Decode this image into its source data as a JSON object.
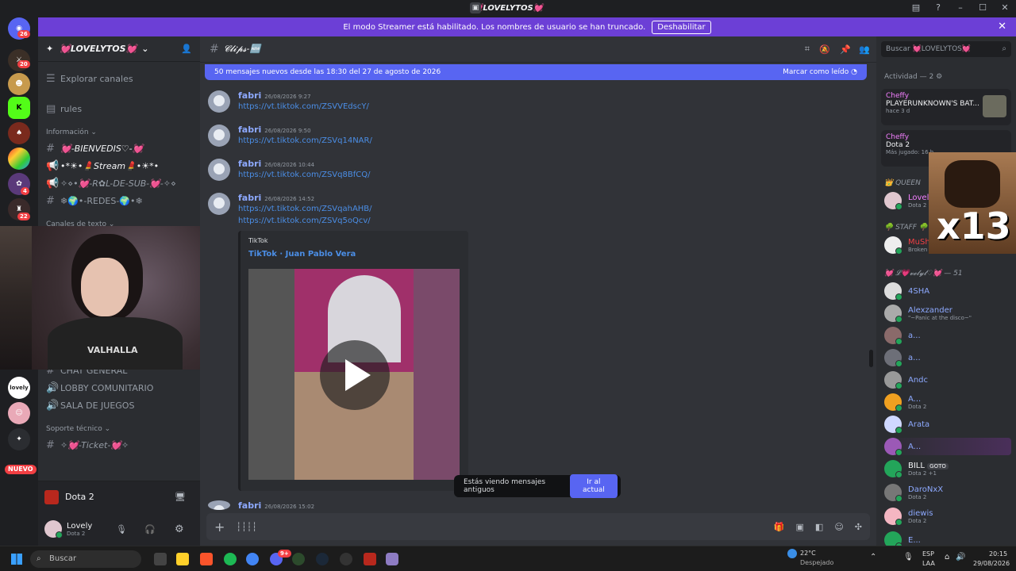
{
  "window": {
    "title": "💓LOVELYTOS💓"
  },
  "streamer": {
    "text": "El modo Streamer está habilitado. Los nombres de usuario se han truncado.",
    "button": "Deshabilitar"
  },
  "guilds": {
    "badge_home": "26",
    "badge_2": "20",
    "badge_3": "4",
    "badge_4": "22",
    "new_label": "NUEVO",
    "lovely_label": "lovely"
  },
  "server": {
    "name": "💓LOVELYTOS💓"
  },
  "sidebar": {
    "explore": "Explorar canales",
    "rules": "rules",
    "cat_info": "Información",
    "ch1": "💓-BIENVEDIS♡-💓",
    "ch2": "•*☀•💄Stream💄•☀*•",
    "ch3": "✧⋄•💓-R✿L-DE-SUB-💓-✧⋄",
    "ch4": "❄🌍•-REDES-🌍•❄",
    "cat_text": "Canales de texto",
    "ch_chat": "CHAT GENERAL",
    "ch_lobby": "LOBBY COMUNITARIO",
    "ch_sala": "SALA DE JUEGOS",
    "cat_support": "Soporte técnico",
    "ch_ticket": "✧💓-Ticket-💓✧"
  },
  "activity_bar": {
    "game": "Dota 2"
  },
  "user": {
    "name": "Lovely",
    "status": "Dota 2"
  },
  "channel": {
    "name": "𝓒𝓵𝓲𝓹𝓼-🆕"
  },
  "newbar": {
    "text": "50 mensajes nuevos desde las 18:30 del 27 de agosto de 2026",
    "action": "Marcar como leído"
  },
  "messages": [
    {
      "author": "fabri",
      "time": "26/08/2026 9:27",
      "link": "https://vt.tiktok.com/ZSVVEdscY/"
    },
    {
      "author": "fabri",
      "time": "26/08/2026 9:50",
      "link": "https://vt.tiktok.com/ZSVq14NAR/"
    },
    {
      "author": "fabri",
      "time": "26/08/2026 10:44",
      "link": "https://vt.tiktok.com/ZSVq8BfCQ/"
    },
    {
      "author": "fabri",
      "time": "26/08/2026 14:52",
      "link": "https://vt.tiktok.com/ZSVqahAHB/",
      "link2": "https://vt.tiktok.com/ZSVq5oQcv/"
    },
    {
      "author": "fabri",
      "time": "26/08/2026 15:02"
    }
  ],
  "embed": {
    "provider": "TikTok",
    "title": "TikTok · Juan Pablo Vera"
  },
  "oldpill": {
    "text": "Estás viendo mensajes antiguos",
    "button": "Ir al actual"
  },
  "right": {
    "search_placeholder": "Buscar 💓LOVELYTOS💓",
    "activity_header": "Actividad — 2",
    "card1": {
      "user": "Cheffy",
      "game": "PLAYERUNKNOWN'S BAT...",
      "meta": "hace 3 d"
    },
    "card2": {
      "user": "Cheffy",
      "game": "Dota 2",
      "meta": "Más jugado: 16 h"
    },
    "cat_queen": "👑 QUEEN",
    "queen_member": {
      "name": "Lovely",
      "sub": "Dota 2"
    },
    "cat_staff": "🌳 STAFF 🌳",
    "staff_member": {
      "name": "MuShU",
      "sub": "Broken"
    },
    "cat_lovelytos": "💓 𝓛💗𝓿𝓮𝓵𝔂𝓽♡💓 — 51",
    "members": [
      {
        "name": "4SHA",
        "sub": ""
      },
      {
        "name": "Alexzander",
        "sub": "\"~Panic at the disco~\""
      },
      {
        "name": "a...",
        "sub": ""
      },
      {
        "name": "a...",
        "sub": ""
      },
      {
        "name": "Andc",
        "sub": ""
      },
      {
        "name": "A...",
        "sub": "Dota 2"
      },
      {
        "name": "Arata",
        "sub": ""
      },
      {
        "name": "A...",
        "sub": ""
      },
      {
        "name": "BILL",
        "sub": "Dota 2 +1",
        "tag": "GOTO"
      },
      {
        "name": "DaroNxX",
        "sub": "Dota 2"
      },
      {
        "name": "diewis",
        "sub": "Dota 2"
      },
      {
        "name": "E...",
        "sub": ""
      }
    ]
  },
  "overlay": {
    "text": "x13"
  },
  "webcam_shirt": "VALHALLA",
  "taskbar": {
    "search": "Buscar",
    "weather_temp": "22°C",
    "weather_desc": "Despejado",
    "lang1": "ESP",
    "lang2": "LAA",
    "time": "20:15",
    "date": "29/08/2026",
    "discord_badge": "9+"
  },
  "colors": {
    "accent": "#5865f2",
    "streamer": "#6c3fd6",
    "link": "#4b8ee6"
  }
}
